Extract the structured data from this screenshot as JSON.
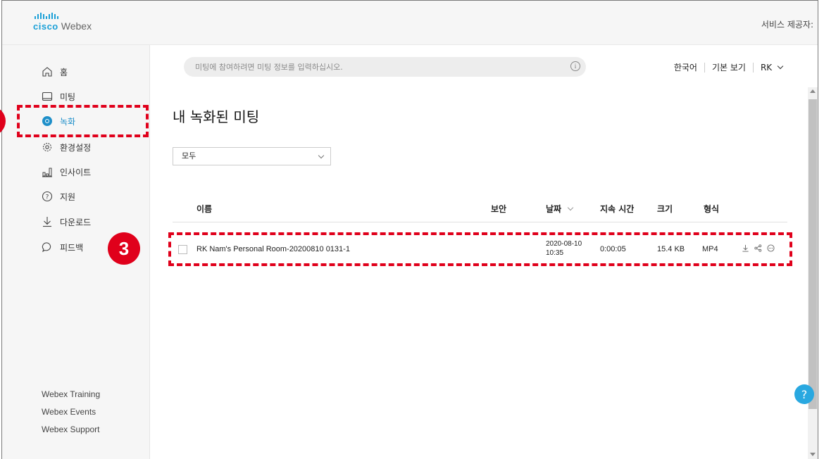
{
  "header": {
    "brand_top": "cisco",
    "brand_name": "Webex",
    "provider": "서비스 제공자:"
  },
  "sidebar": {
    "items": [
      {
        "label": "홈",
        "icon": "home-icon"
      },
      {
        "label": "미팅",
        "icon": "calendar-icon"
      },
      {
        "label": "녹화",
        "icon": "recording-icon"
      },
      {
        "label": "환경설정",
        "icon": "gear-icon"
      },
      {
        "label": "인사이트",
        "icon": "chart-icon"
      },
      {
        "label": "지원",
        "icon": "help-circle-icon"
      },
      {
        "label": "다운로드",
        "icon": "download-icon"
      },
      {
        "label": "피드백",
        "icon": "chat-icon"
      }
    ],
    "active": "녹화",
    "footer_links": [
      "Webex Training",
      "Webex Events",
      "Webex Support"
    ]
  },
  "search": {
    "placeholder": "미팅에 참여하려면 미팅 정보를 입력하십시오."
  },
  "top_right": {
    "language": "한국어",
    "view": "기본 보기",
    "user": "RK"
  },
  "main": {
    "title": "내 녹화된 미팅",
    "filter": "모두",
    "columns": {
      "name": "이름",
      "security": "보안",
      "date": "날짜",
      "duration": "지속 시간",
      "size": "크기",
      "format": "형식"
    },
    "rows": [
      {
        "name": "RK Nam's Personal Room-20200810 0131-1",
        "date": "2020-08-10",
        "time": "10:35",
        "duration": "0:00:05",
        "size": "15.4 KB",
        "format": "MP4"
      }
    ]
  },
  "annotations": {
    "step_number": "3"
  },
  "colors": {
    "accent": "#1e8fc9",
    "highlight": "#e0001b",
    "sidebar_bg": "#f6f6f6"
  }
}
